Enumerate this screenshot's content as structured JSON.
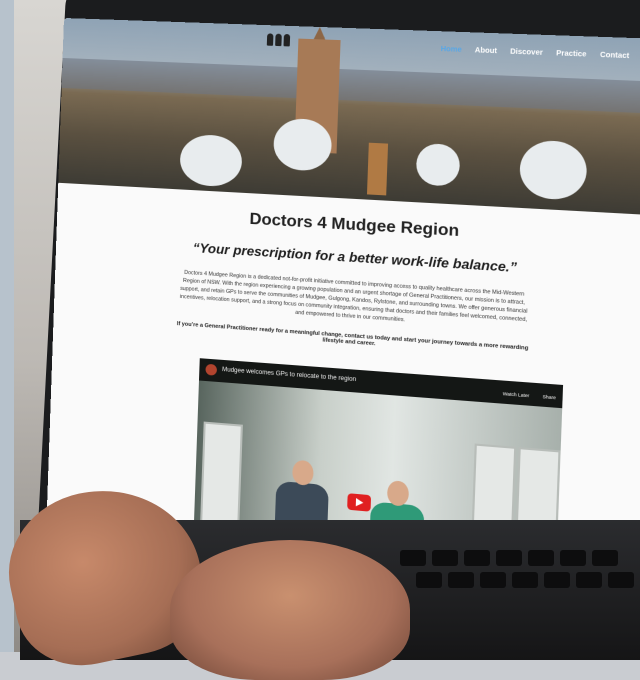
{
  "navigation": {
    "items": [
      "Home",
      "About",
      "Discover",
      "Practice",
      "Contact"
    ],
    "active": "Home",
    "search_icon": "magnifier-icon"
  },
  "page": {
    "title": "Doctors 4 Mudgee Region",
    "tagline": "“Your prescription for a better work-life balance.”",
    "intro": "Doctors 4 Mudgee Region is a dedicated not-for-profit initiative committed to improving access to quality healthcare across the Mid-Western Region of NSW. With the region experiencing a growing population and an urgent shortage of General Practitioners, our mission is to attract, support, and retain GPs to serve the communities of Mudgee, Gulgong, Kandos, Rylstone, and surrounding towns. We offer generous financial incentives, relocation support, and a strong focus on community integration, ensuring that doctors and their families feel welcomed, connected, and empowered to thrive in our communities.",
    "cta": "If you’re a General Practitioner ready for a meaningful change, contact us today and start your journey towards a more rewarding lifestyle and career."
  },
  "video": {
    "title": "Mudgee welcomes GPs to relocate to the region",
    "watch_later": "Watch Later",
    "share": "Share"
  },
  "colors": {
    "nav_active": "#59a7e6",
    "play_button": "#e02020"
  }
}
